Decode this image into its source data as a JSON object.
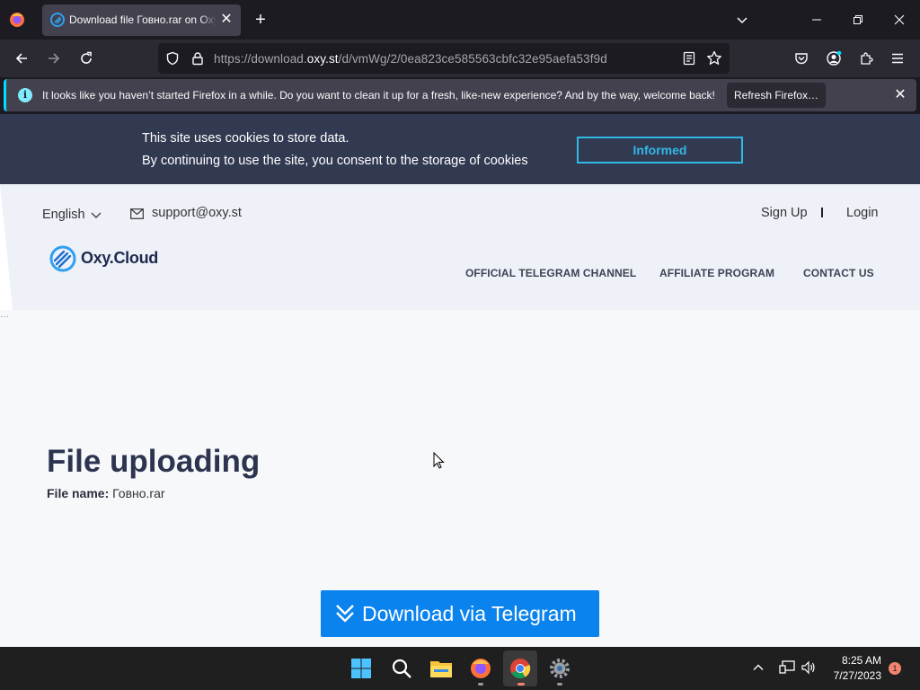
{
  "browser": {
    "tab": {
      "title": "Download file Говно.rar on Oxy.Cloud"
    },
    "url": {
      "prefix": "https://download.",
      "host": "oxy.st",
      "path": "/d/vmWg/2/0ea823ce585563cbfc32e95aefa53f9d"
    },
    "notification": {
      "text": "It looks like you haven’t started Firefox in a while. Do you want to clean it up for a fresh, like-new experience? And by the way, welcome back!",
      "button": "Refresh Firefox…"
    }
  },
  "cookie_banner": {
    "line1": "This site uses cookies to store data.",
    "line2": "By continuing to use the site, you consent to the storage of cookies",
    "button": "Informed"
  },
  "header": {
    "language": "English",
    "support_email": "support@oxy.st",
    "signup": "Sign Up",
    "login": "Login",
    "logo_text": "Oxy.Cloud",
    "nav": [
      "OFFICIAL TELEGRAM CHANNEL",
      "AFFILIATE PROGRAM",
      "CONTACT US"
    ]
  },
  "main": {
    "title": "File uploading",
    "filename_label": "File name:",
    "filename_value": "Говно.rar",
    "download_button": "Download via Telegram"
  },
  "taskbar": {
    "time": "8:25 AM",
    "date": "7/27/2023",
    "notification_count": "1"
  },
  "colors": {
    "accent_button": "#0a83ee",
    "cookie_bg": "#323a52",
    "cookie_button": "#33b8e6",
    "title": "#2c3450"
  }
}
